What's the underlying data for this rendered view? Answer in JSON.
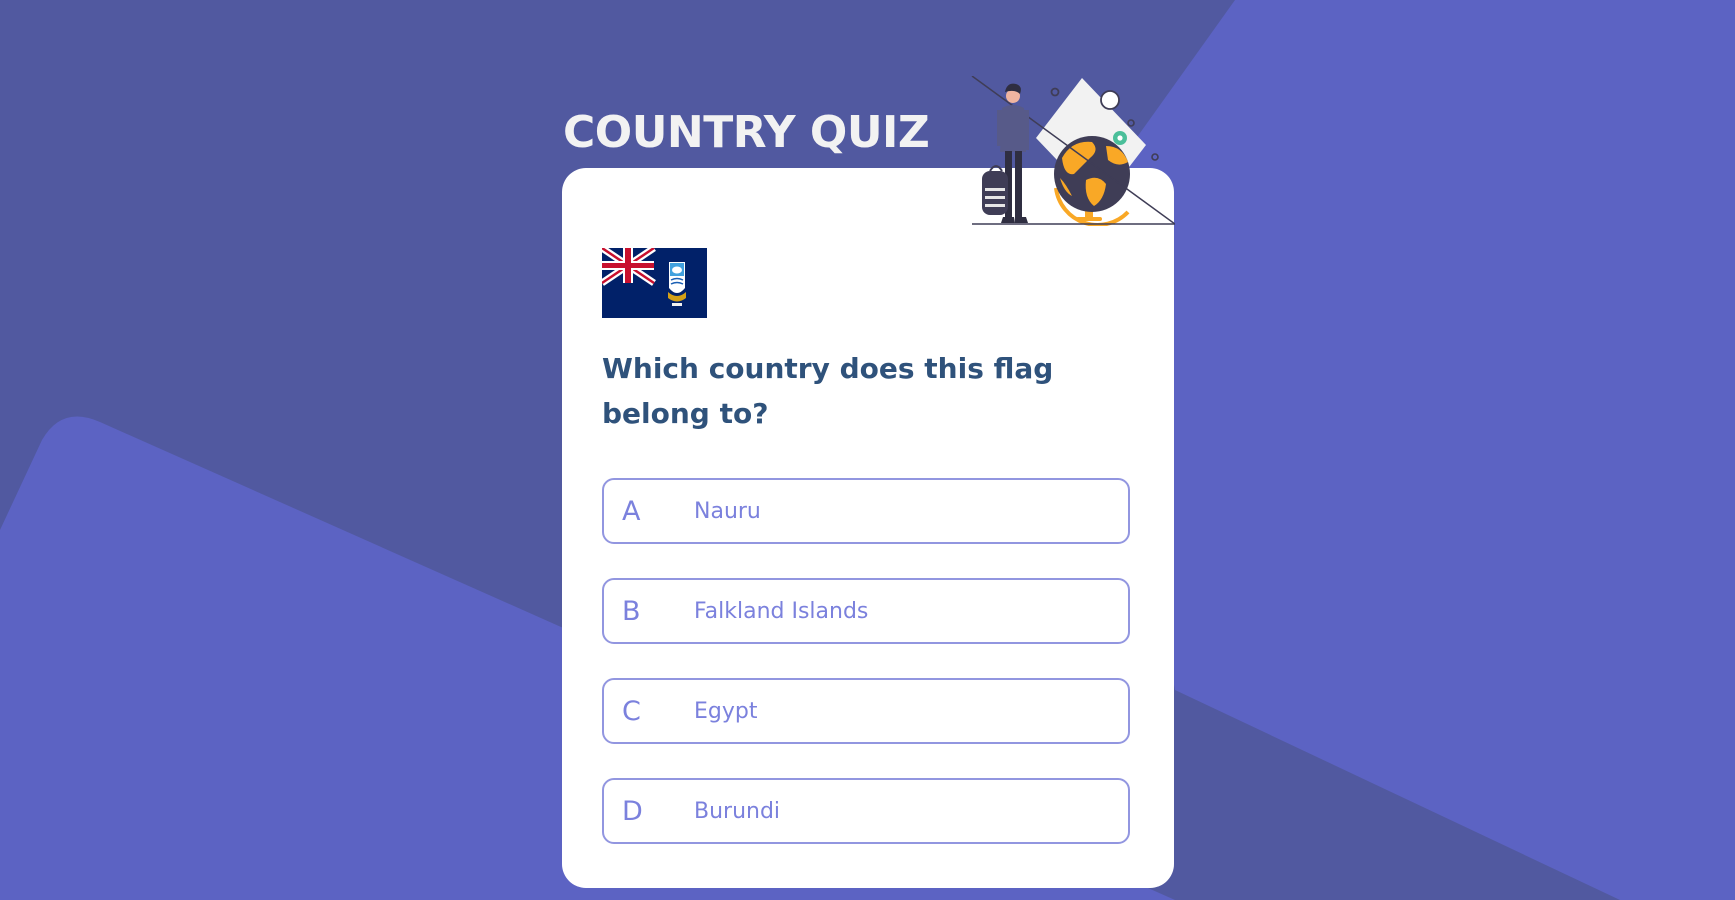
{
  "app": {
    "title": "COUNTRY QUIZ"
  },
  "question": {
    "text": "Which country does this flag belong to?",
    "flag_icon": "falkland-islands-flag"
  },
  "options": [
    {
      "letter": "A",
      "text": "Nauru"
    },
    {
      "letter": "B",
      "text": "Falkland Islands"
    },
    {
      "letter": "C",
      "text": "Egypt"
    },
    {
      "letter": "D",
      "text": "Burundi"
    }
  ],
  "colors": {
    "background": "#5159a0",
    "background_shape": "#5c63c3",
    "title": "#f2f2f2",
    "card": "#ffffff",
    "question": "#2f527b",
    "option_border": "#9296e0",
    "option_text": "#7b81dd",
    "accent_globe": "#f9a826"
  },
  "illustration": {
    "icon": "traveler-with-globe-illustration"
  }
}
